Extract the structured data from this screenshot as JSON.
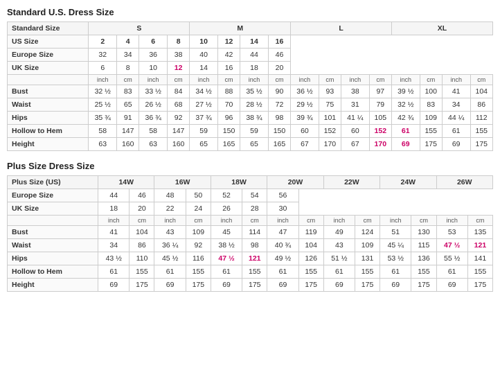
{
  "standard_title": "Standard U.S. Dress Size",
  "plus_title": "Plus Size Dress Size",
  "standard": {
    "size_groups": [
      {
        "label": "S",
        "cols": 2
      },
      {
        "label": "M",
        "cols": 2
      },
      {
        "label": "L",
        "cols": 2
      },
      {
        "label": "XL",
        "cols": 2
      }
    ],
    "headers": [
      "Standard Size",
      "S",
      "",
      "S",
      "",
      "M",
      "",
      "M",
      "",
      "L",
      "",
      "L",
      "",
      "XL",
      "",
      "XL",
      ""
    ],
    "us_sizes": [
      "US Size",
      "2",
      "4",
      "6",
      "8",
      "10",
      "12",
      "14",
      "16"
    ],
    "europe_sizes": [
      "Europe Size",
      "32",
      "34",
      "36",
      "38",
      "40",
      "42",
      "44",
      "46"
    ],
    "uk_sizes": [
      "UK Size",
      "6",
      "8",
      "10",
      "12",
      "14",
      "16",
      "18",
      "20"
    ],
    "units": [
      "",
      "inch",
      "cm",
      "inch",
      "cm",
      "inch",
      "cm",
      "inch",
      "cm",
      "inch",
      "cm",
      "inch",
      "cm",
      "inch",
      "cm",
      "inch",
      "cm"
    ],
    "bust": [
      "Bust",
      "32 ½",
      "83",
      "33 ½",
      "84",
      "34 ½",
      "88",
      "35 ½",
      "90",
      "36 ½",
      "93",
      "38",
      "97",
      "39 ½",
      "100",
      "41",
      "104"
    ],
    "waist": [
      "Waist",
      "25 ½",
      "65",
      "26 ½",
      "68",
      "27 ½",
      "70",
      "28 ½",
      "72",
      "29 ½",
      "75",
      "31",
      "79",
      "32 ½",
      "83",
      "34",
      "86"
    ],
    "hips": [
      "Hips",
      "35 ¾",
      "91",
      "36 ¾",
      "92",
      "37 ¾",
      "96",
      "38 ¾",
      "98",
      "39 ¾",
      "101",
      "41 ¼",
      "105",
      "42 ¾",
      "109",
      "44 ¼",
      "112"
    ],
    "hollow": [
      "Hollow to Hem",
      "58",
      "147",
      "58",
      "147",
      "59",
      "150",
      "59",
      "150",
      "60",
      "152",
      "60",
      "152",
      "61",
      "155",
      "61",
      "155"
    ],
    "height": [
      "Height",
      "63",
      "160",
      "63",
      "160",
      "65",
      "165",
      "65",
      "165",
      "67",
      "170",
      "67",
      "170",
      "69",
      "175",
      "69",
      "175"
    ]
  },
  "plus": {
    "size_headers": [
      "Plus Size (US)",
      "14W",
      "16W",
      "18W",
      "20W",
      "22W",
      "24W",
      "26W"
    ],
    "europe_sizes": [
      "Europe Size",
      "44",
      "46",
      "48",
      "50",
      "52",
      "54",
      "56"
    ],
    "uk_sizes": [
      "UK Size",
      "18",
      "20",
      "22",
      "24",
      "26",
      "28",
      "30"
    ],
    "units": [
      "",
      "inch",
      "cm",
      "inch",
      "cm",
      "inch",
      "cm",
      "inch",
      "cm",
      "inch",
      "cm",
      "inch",
      "cm",
      "inch",
      "cm"
    ],
    "bust": [
      "Bust",
      "41",
      "104",
      "43",
      "109",
      "45",
      "114",
      "47",
      "119",
      "49",
      "124",
      "51",
      "130",
      "53",
      "135"
    ],
    "waist": [
      "Waist",
      "34",
      "86",
      "36 ¼",
      "92",
      "38 ½",
      "98",
      "40 ¾",
      "104",
      "43",
      "109",
      "45 ¼",
      "115",
      "47 ½",
      "121"
    ],
    "hips": [
      "Hips",
      "43 ½",
      "110",
      "45 ½",
      "116",
      "47 ½",
      "121",
      "49 ½",
      "126",
      "51 ½",
      "131",
      "53 ½",
      "136",
      "55 ½",
      "141"
    ],
    "hollow": [
      "Hollow to Hem",
      "61",
      "155",
      "61",
      "155",
      "61",
      "155",
      "61",
      "155",
      "61",
      "155",
      "61",
      "155",
      "61",
      "155"
    ],
    "height": [
      "Height",
      "69",
      "175",
      "69",
      "175",
      "69",
      "175",
      "69",
      "175",
      "69",
      "175",
      "69",
      "175",
      "69",
      "175"
    ]
  },
  "highlight_indices_standard_uk": [
    4
  ],
  "highlight_indices_standard_hollow": [
    12,
    13
  ],
  "highlight_indices_standard_height": [
    12,
    13
  ],
  "highlight_plus_waist": [
    13,
    14,
    15
  ],
  "highlight_plus_hips": [
    5,
    6
  ]
}
